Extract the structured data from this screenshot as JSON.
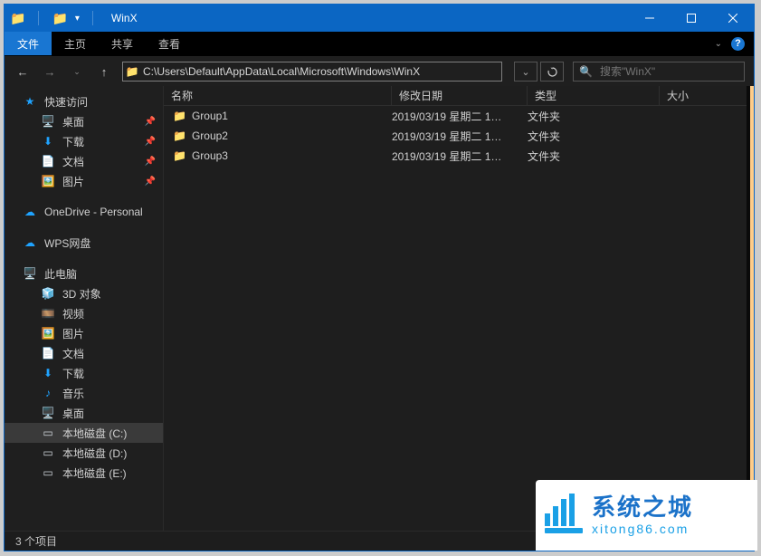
{
  "title": "WinX",
  "ribbon": {
    "file": "文件",
    "tabs": [
      "主页",
      "共享",
      "查看"
    ]
  },
  "nav": {
    "address": "C:\\Users\\Default\\AppData\\Local\\Microsoft\\Windows\\WinX",
    "search_placeholder": "搜索\"WinX\""
  },
  "columns": {
    "name": "名称",
    "date": "修改日期",
    "type": "类型",
    "size": "大小"
  },
  "sidebar": {
    "quick_access": "快速访问",
    "quick_items": [
      {
        "icon": "desktop-icon",
        "label": "桌面",
        "pinned": true,
        "color": "#1fa3ff"
      },
      {
        "icon": "download-icon",
        "label": "下载",
        "pinned": true,
        "color": "#1fa3ff"
      },
      {
        "icon": "document-icon",
        "label": "文档",
        "pinned": true,
        "color": "#bfc9d6"
      },
      {
        "icon": "picture-icon",
        "label": "图片",
        "pinned": true,
        "color": "#1fa3ff"
      }
    ],
    "onedrive": "OneDrive - Personal",
    "wps": "WPS网盘",
    "this_pc": "此电脑",
    "pc_items": [
      {
        "icon": "cube-icon",
        "label": "3D 对象",
        "color": "#17b0d8"
      },
      {
        "icon": "video-icon",
        "label": "视频",
        "color": "#d08030"
      },
      {
        "icon": "picture-icon",
        "label": "图片",
        "color": "#1fa3ff"
      },
      {
        "icon": "document-icon",
        "label": "文档",
        "color": "#bfc9d6"
      },
      {
        "icon": "download-icon",
        "label": "下载",
        "color": "#1fa3ff"
      },
      {
        "icon": "music-icon",
        "label": "音乐",
        "color": "#1fa3ff"
      },
      {
        "icon": "desktop-icon",
        "label": "桌面",
        "color": "#1fa3ff"
      },
      {
        "icon": "drive-icon",
        "label": "本地磁盘 (C:)",
        "color": "#cfd5da",
        "selected": true
      },
      {
        "icon": "drive-icon",
        "label": "本地磁盘 (D:)",
        "color": "#cfd5da"
      },
      {
        "icon": "drive-icon",
        "label": "本地磁盘 (E:)",
        "color": "#cfd5da"
      }
    ]
  },
  "files": [
    {
      "name": "Group1",
      "date": "2019/03/19 星期二 1…",
      "type": "文件夹"
    },
    {
      "name": "Group2",
      "date": "2019/03/19 星期二 1…",
      "type": "文件夹"
    },
    {
      "name": "Group3",
      "date": "2019/03/19 星期二 1…",
      "type": "文件夹"
    }
  ],
  "status": "3 个项目",
  "watermark": {
    "title": "系统之城",
    "url": "xitong86.com"
  }
}
